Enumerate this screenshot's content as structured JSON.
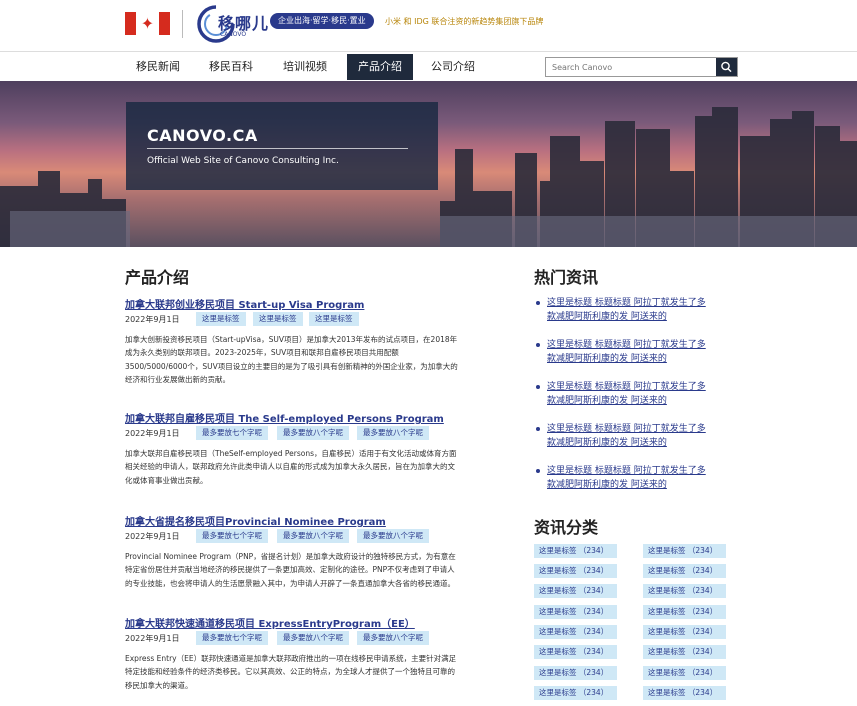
{
  "header": {
    "logo_text": "移哪儿",
    "logo_sub": "CANOVO",
    "slogan": "企业出海·留学·移民·置业",
    "tagline": "小米 和 IDG 联合注资的新趋势集团旗下品牌"
  },
  "nav": {
    "items": [
      {
        "label": "移民新闻",
        "active": false
      },
      {
        "label": "移民百科",
        "active": false
      },
      {
        "label": "培训视频",
        "active": false
      },
      {
        "label": "产品介绍",
        "active": true
      },
      {
        "label": "公司介绍",
        "active": false
      }
    ],
    "search_placeholder": "Search Canovo"
  },
  "hero": {
    "title": "CANOVO.CA",
    "subtitle": "Official Web Site of Canovo Consulting Inc."
  },
  "main": {
    "section_title": "产品介绍",
    "posts": [
      {
        "title": "加拿大联邦创业移民项目 Start-up Visa Program",
        "date": "2022年9月1日",
        "tags": [
          "这里是标签",
          "这里是标签",
          "这里是标签"
        ],
        "lines": [
          "加拿大创新投资移民项目（Start-upVisa，SUV项目）是加拿大2013年发布的试点项目，在2018年",
          "成为永久类别的联邦项目。2023-2025年，SUV项目和联邦自雇移民项目共用配额",
          "3500/5000/6000个，SUV项目设立的主要目的是为了吸引具有创新精神的外国企业家，为加拿大的",
          "经济和行业发展做出新的贡献。"
        ]
      },
      {
        "title": "加拿大联邦自雇移民项目 The Self-employed Persons Program",
        "date": "2022年9月1日",
        "tags": [
          "最多要放七个字呢",
          "最多要放八个字呢",
          "最多要放八个字呢"
        ],
        "lines": [
          "加拿大联邦自雇移民项目（TheSelf-employed Persons，自雇移民）适用于有文化活动或体育方面",
          "相关经验的申请人，联邦政府允许此类申请人以自雇的形式成为加拿大永久居民，旨在为加拿大的文",
          "化或体育事业做出贡献。"
        ]
      },
      {
        "title": "加拿大省提名移民项目Provincial Nominee Program",
        "date": "2022年9月1日",
        "tags": [
          "最多要放七个字呢",
          "最多要放八个字呢",
          "最多要放八个字呢"
        ],
        "lines": [
          "Provincial Nominee Program（PNP，省提名计划）是加拿大政府设计的独特移民方式，为有意在",
          "特定省份居住并贡献当地经济的移民提供了一条更加高效、定制化的途径。PNP不仅考虑到了申请人",
          "的专业技能，也会将申请人的生活愿景融入其中，为申请人开辟了一条直通加拿大各省的移民通道。"
        ]
      },
      {
        "title": "加拿大联邦快速通道移民项目 ExpressEntryProgram（EE）",
        "date": "2022年9月1日",
        "tags": [
          "最多要放七个字呢",
          "最多要放八个字呢",
          "最多要放八个字呢"
        ],
        "lines": [
          "Express Entry（EE）联邦快速通道是加拿大联邦政府推出的一项在线移民申请系统，主要针对满足",
          "特定技能和经验条件的经济类移民。它以其高效、公正的特点，为全球人才提供了一个独特且可靠的",
          "移民加拿大的渠道。"
        ]
      }
    ]
  },
  "sidebar": {
    "news_title": "热门资讯",
    "news": [
      {
        "line1": "这里是标题 标题标题 阿拉丁就发生了多",
        "line2": "款减肥阿斯利康的发 阿送来的"
      },
      {
        "line1": "这里是标题 标题标题 阿拉丁就发生了多",
        "line2": "款减肥阿斯利康的发 阿送来的"
      },
      {
        "line1": "这里是标题 标题标题 阿拉丁就发生了多",
        "line2": "款减肥阿斯利康的发 阿送来的"
      },
      {
        "line1": "这里是标题 标题标题 阿拉丁就发生了多",
        "line2": "款减肥阿斯利康的发 阿送来的"
      },
      {
        "line1": "这里是标题 标题标题 阿拉丁就发生了多",
        "line2": "款减肥阿斯利康的发 阿送来的"
      }
    ],
    "categories_title": "资讯分类",
    "categories": [
      "这里是标签 （234）",
      "这里是标签 （234）",
      "这里是标签 （234）",
      "这里是标签 （234）",
      "这里是标签 （234）",
      "这里是标签 （234）",
      "这里是标签 （234）",
      "这里是标签 （234）",
      "这里是标签 （234）",
      "这里是标签 （234）",
      "这里是标签 （234）",
      "这里是标签 （234）",
      "这里是标签 （234）",
      "这里是标签 （234）",
      "这里是标签 （234）",
      "这里是标签 （234）"
    ]
  },
  "colors": {
    "brand": "#2a3a8c",
    "nav_active": "#1f2a3c",
    "tag_bg": "#cfe8f6",
    "flag_red": "#d52b1e"
  },
  "icons": {
    "flag": "canada-flag-icon",
    "logo": "canovo-logo-icon",
    "search": "search-icon"
  }
}
